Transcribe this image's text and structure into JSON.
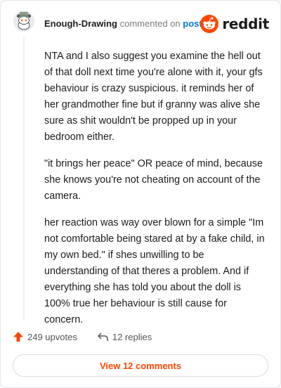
{
  "header": {
    "author": "Enough-Drawing",
    "verb": "commented on",
    "post_link": "post",
    "brand": "reddit"
  },
  "comment": {
    "paragraphs": [
      "NTA and I also suggest you examine the hell out of that doll next time you're alone with it, your gfs behaviour is crazy suspicious. it reminds her of her grandmother fine but if granny was alive she sure as shit wouldn't be propped up in your bedroom either.",
      "\"it brings her peace\" OR peace of mind, because she knows you're not cheating on account of the camera.",
      "her reaction was way over blown for a simple \"Im not comfortable being stared at by a fake child, in my own bed.\" if shes unwilling to be understanding of that theres a problem. And if everything she has told you about the doll is 100% true her behaviour is still cause for concern."
    ]
  },
  "actions": {
    "upvotes": "249 upvotes",
    "replies": "12 replies",
    "view_comments": "View 12 comments"
  },
  "colors": {
    "accent": "#ff4500",
    "link": "#0079d3"
  },
  "icons": [
    "avatar-icon",
    "reddit-logo-icon",
    "upvote-arrow-icon",
    "reply-icon"
  ]
}
